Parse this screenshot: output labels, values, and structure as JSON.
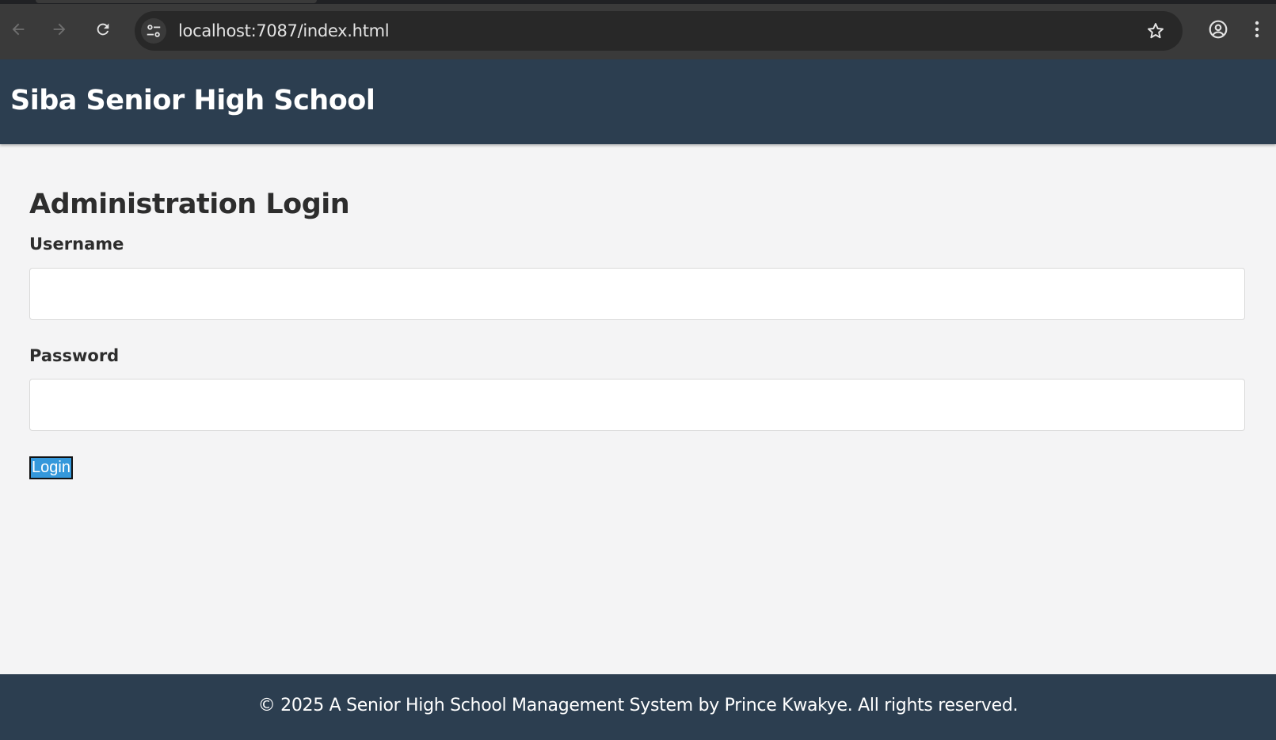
{
  "browser": {
    "url": "localhost:7087/index.html",
    "icons": [
      "back-arrow-icon",
      "forward-arrow-icon",
      "reload-icon",
      "site-info-icon",
      "bookmark-star-icon",
      "profile-icon",
      "more-menu-icon"
    ]
  },
  "header": {
    "title": "Siba Senior High School"
  },
  "main": {
    "heading": "Administration Login",
    "username_label": "Username",
    "username_value": "",
    "password_label": "Password",
    "password_value": "",
    "login_label": "Login"
  },
  "footer": {
    "text": "© 2025 A Senior High School Management System by Prince Kwakye. All rights reserved."
  },
  "colors": {
    "header_bg": "#2c3e50",
    "page_bg": "#f4f4f5",
    "button_bg": "#3498db",
    "text_dark": "#2d2d2d"
  }
}
